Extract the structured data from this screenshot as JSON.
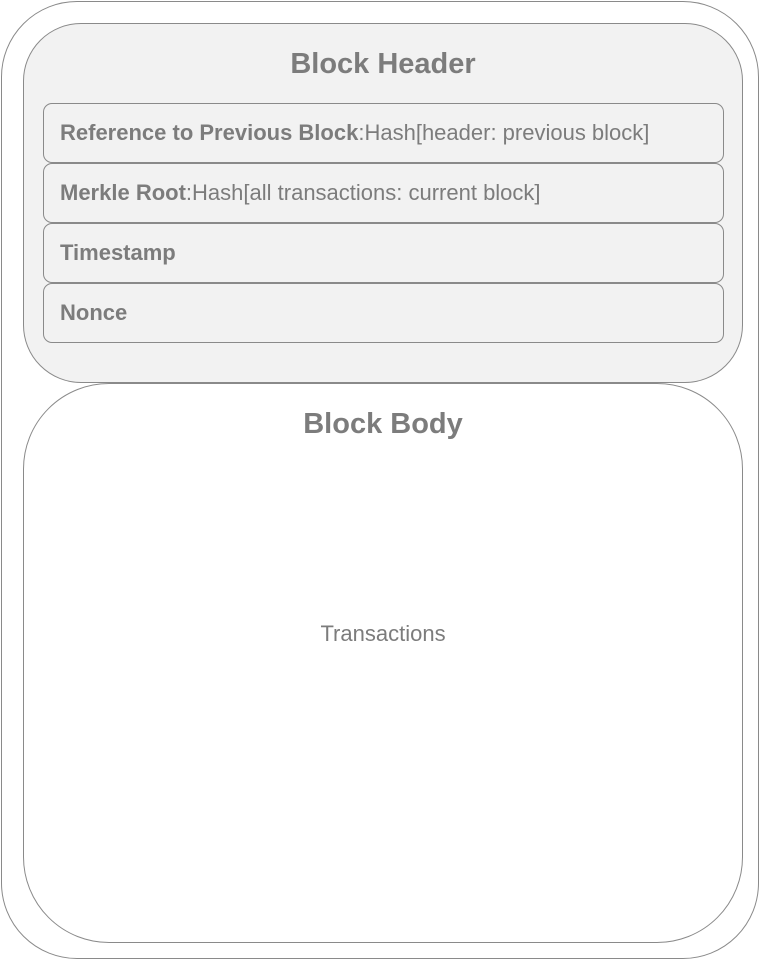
{
  "block_header": {
    "title": "Block Header",
    "fields": [
      {
        "name": "Reference to Previous Block",
        "separator": ": ",
        "value": "Hash[header: previous block]"
      },
      {
        "name": "Merkle Root",
        "separator": ": ",
        "value": "Hash[all transactions: current block]"
      },
      {
        "name": "Timestamp",
        "separator": "",
        "value": ""
      },
      {
        "name": "Nonce",
        "separator": "",
        "value": ""
      }
    ]
  },
  "block_body": {
    "title": "Block Body",
    "content": "Transactions"
  }
}
